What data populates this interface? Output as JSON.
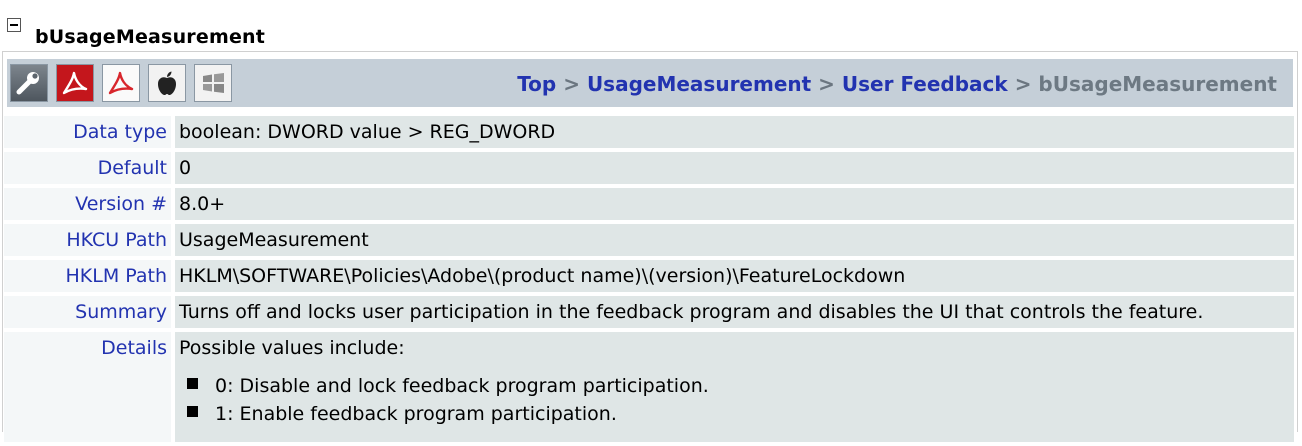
{
  "title": "bUsageMeasurement",
  "toolbar": {
    "icons": [
      "wrench-icon",
      "pdf-red-icon",
      "pdf-white-icon",
      "apple-icon",
      "windows-icon"
    ]
  },
  "breadcrumb": {
    "items": [
      "Top",
      "UsageMeasurement",
      "User Feedback"
    ],
    "separator": ">",
    "current": "bUsageMeasurement"
  },
  "properties": {
    "data_type": {
      "label": "Data type",
      "value": "boolean: DWORD value > REG_DWORD"
    },
    "default": {
      "label": "Default",
      "value": "0"
    },
    "version": {
      "label": "Version #",
      "value": "8.0+"
    },
    "hkcu": {
      "label": "HKCU Path",
      "value": "UsageMeasurement"
    },
    "hklm": {
      "label": "HKLM Path",
      "value": "HKLM\\SOFTWARE\\Policies\\Adobe\\(product name)\\(version)\\FeatureLockdown"
    },
    "summary": {
      "label": "Summary",
      "value": "Turns off and locks user participation in the feedback program and disables the UI that controls the feature."
    },
    "details": {
      "label": "Details",
      "intro": "Possible values include:",
      "options": [
        "0: Disable and lock feedback program participation.",
        "1: Enable feedback program participation."
      ]
    }
  },
  "colors": {
    "link": "#2233b0",
    "toolbar_bg": "#c5cfd8",
    "value_bg": "#dfe6e6"
  }
}
